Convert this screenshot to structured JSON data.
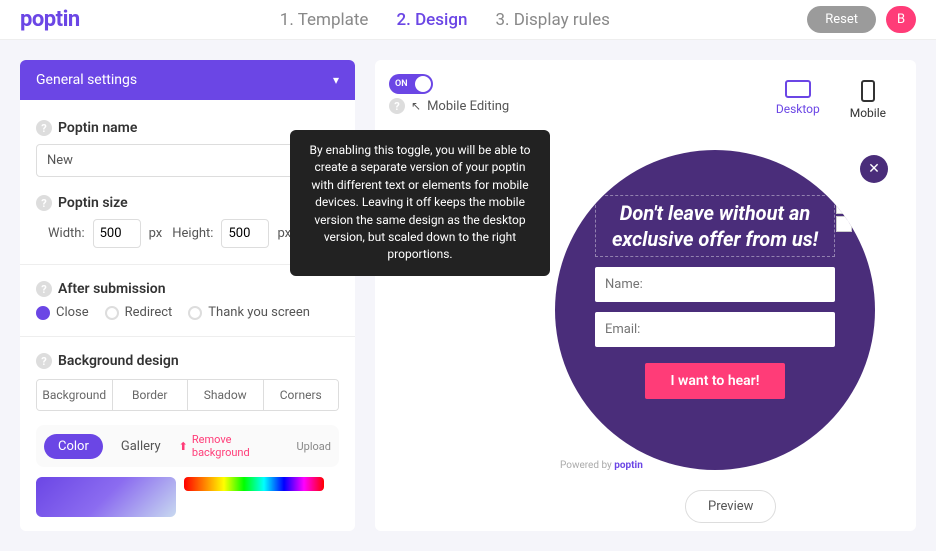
{
  "brand": "poptin",
  "steps": {
    "s1": "1. Template",
    "s2": "2. Design",
    "s3": "3. Display rules"
  },
  "top": {
    "reset": "Reset",
    "buy": "B"
  },
  "section": {
    "title": "General settings"
  },
  "fields": {
    "name_label": "Poptin name",
    "name_value": "New",
    "size_label": "Poptin size",
    "width_label": "Width:",
    "width_value": "500",
    "height_label": "Height:",
    "height_value": "500",
    "px": "px"
  },
  "after": {
    "label": "After submission",
    "close": "Close",
    "redirect": "Redirect",
    "thank": "Thank you screen"
  },
  "bg": {
    "label": "Background design",
    "tabs": {
      "background": "Background",
      "border": "Border",
      "shadow": "Shadow",
      "corners": "Corners"
    },
    "color": "Color",
    "gallery": "Gallery",
    "remove": "Remove background",
    "upload": "Upload"
  },
  "canvas": {
    "toggle_on": "ON",
    "mobile_editing": "Mobile Editing",
    "tooltip": "By enabling this toggle, you will be able to create a separate version of your poptin with different text or elements for mobile devices. Leaving it off keeps the mobile version the same design as the desktop version, but scaled down to the right proportions.",
    "desktop": "Desktop",
    "mobile": "Mobile",
    "preview": "Preview",
    "powered_prefix": "Powered by ",
    "powered_brand": "poptin"
  },
  "popup": {
    "title": "Don't leave without an exclusive offer from us!",
    "name_ph": "Name:",
    "email_ph": "Email:",
    "cta": "I want to hear!"
  }
}
